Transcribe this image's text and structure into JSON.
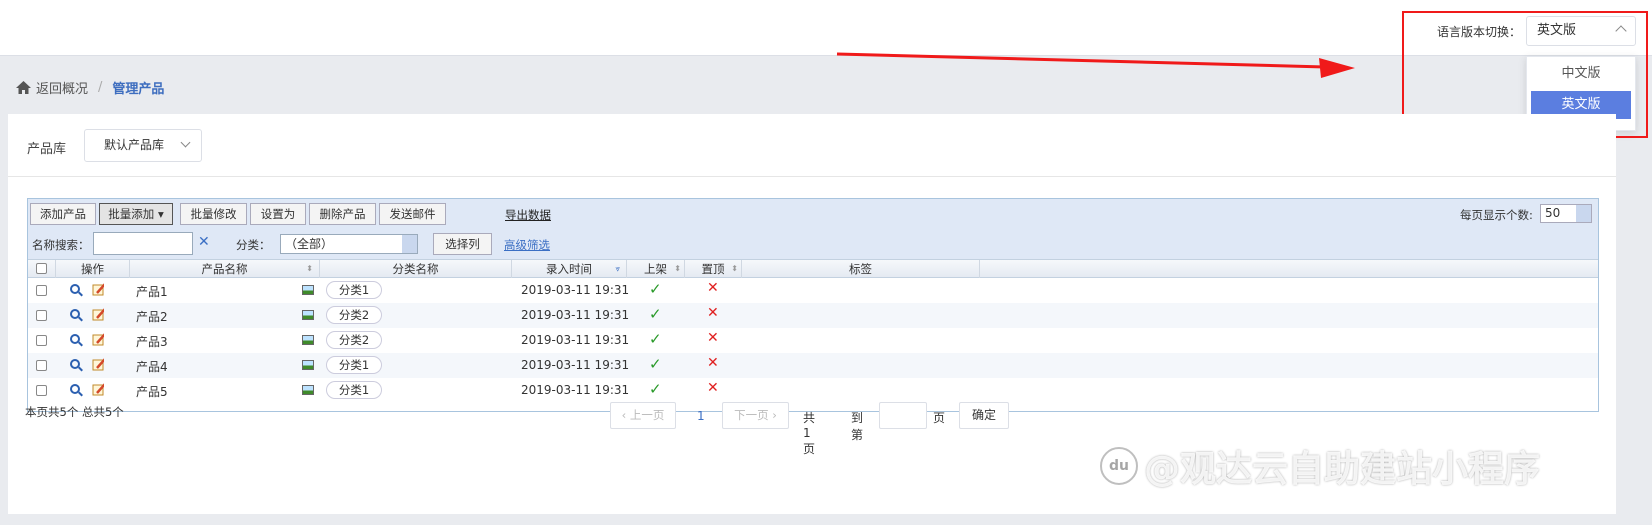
{
  "lang_switch": {
    "label": "语言版本切换：",
    "current": "英文版",
    "options": [
      "中文版",
      "英文版"
    ],
    "selected_index": 1
  },
  "breadcrumb": {
    "back": "返回概况",
    "separator": "/",
    "current": "管理产品"
  },
  "library": {
    "label": "产品库",
    "value": "默认产品库"
  },
  "toolbar": {
    "add": "添加产品",
    "batch_add": "批量添加",
    "batch_edit": "批量修改",
    "set_as": "设置为",
    "delete": "删除产品",
    "send_mail": "发送邮件",
    "export": "导出数据",
    "per_page_label": "每页显示个数:",
    "per_page": "50"
  },
  "search": {
    "name_label": "名称搜索：",
    "name_value": "",
    "category_label": "分类：",
    "category_value": "（全部）",
    "select_columns": "选择列",
    "advanced_filter": "高级筛选"
  },
  "columns": [
    "操作",
    "产品名称",
    "分类名称",
    "录入时间",
    "上架",
    "置顶",
    "标签"
  ],
  "rows": [
    {
      "name": "产品1",
      "category": "分类1",
      "time": "2019-03-11 19:31",
      "listed": true,
      "top": false
    },
    {
      "name": "产品2",
      "category": "分类2",
      "time": "2019-03-11 19:31",
      "listed": true,
      "top": false
    },
    {
      "name": "产品3",
      "category": "分类2",
      "time": "2019-03-11 19:31",
      "listed": true,
      "top": false
    },
    {
      "name": "产品4",
      "category": "分类1",
      "time": "2019-03-11 19:31",
      "listed": true,
      "top": false
    },
    {
      "name": "产品5",
      "category": "分类1",
      "time": "2019-03-11 19:31",
      "listed": true,
      "top": false
    }
  ],
  "summary": "本页共5个 总共5个",
  "pager": {
    "prev": "上一页",
    "current": "1",
    "next": "下一页",
    "total": "共 1 页",
    "goto": "到第",
    "page_unit": "页",
    "confirm": "确定"
  },
  "watermark": "@观达云自助建站小程序",
  "colors": {
    "accent": "#5b7ee0",
    "highlight": "#f01a1a",
    "tick": "#2a9a2a",
    "cross": "#e02020"
  }
}
